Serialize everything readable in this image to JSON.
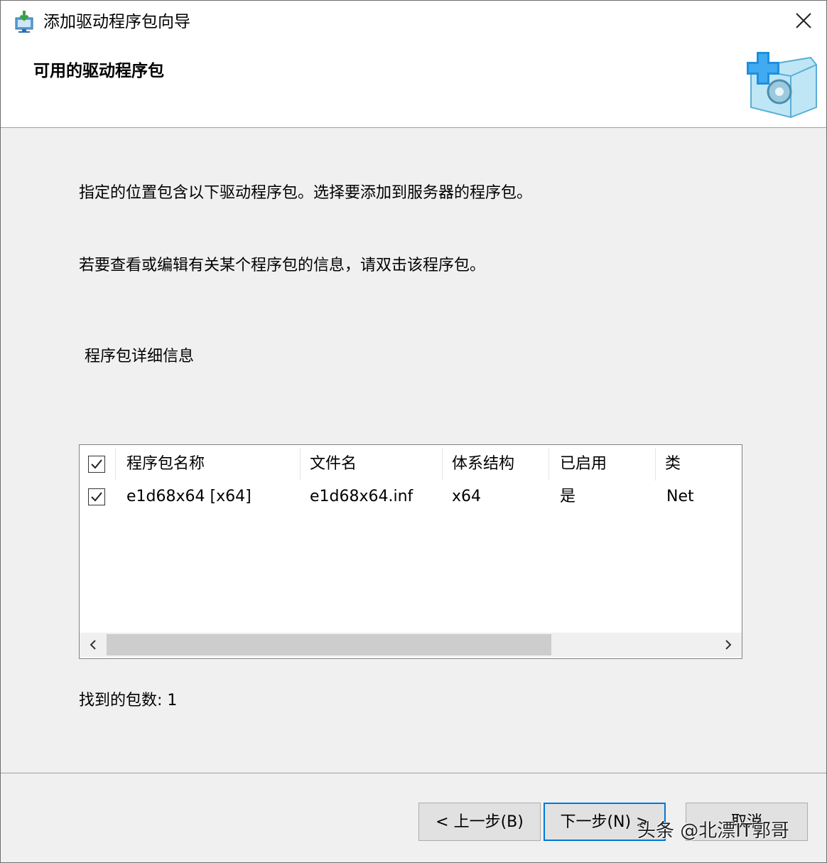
{
  "window": {
    "title": "添加驱动程序包向导",
    "page_title": "可用的驱动程序包"
  },
  "content": {
    "description1": "指定的位置包含以下驱动程序包。选择要添加到服务器的程序包。",
    "description2": "若要查看或编辑有关某个程序包的信息，请双击该程序包。",
    "section_label": "程序包详细信息",
    "package_count_label": "找到的包数: 1"
  },
  "list": {
    "columns": [
      "程序包名称",
      "文件名",
      "体系结构",
      "已启用",
      "类"
    ],
    "rows": [
      {
        "name": "e1d68x64 [x64]",
        "file": "e1d68x64.inf",
        "arch": "x64",
        "enabled": "是",
        "class": "Net",
        "checked": true
      }
    ],
    "header_checked": true
  },
  "buttons": {
    "back": "< 上一步(B)",
    "next": "下一步(N) >",
    "cancel": "取消"
  },
  "watermark": "头条 @北漂IT郭哥",
  "colors": {
    "accent": "#0078d7",
    "header_bg": "#ffffff",
    "body_bg": "#f0f0f0"
  }
}
